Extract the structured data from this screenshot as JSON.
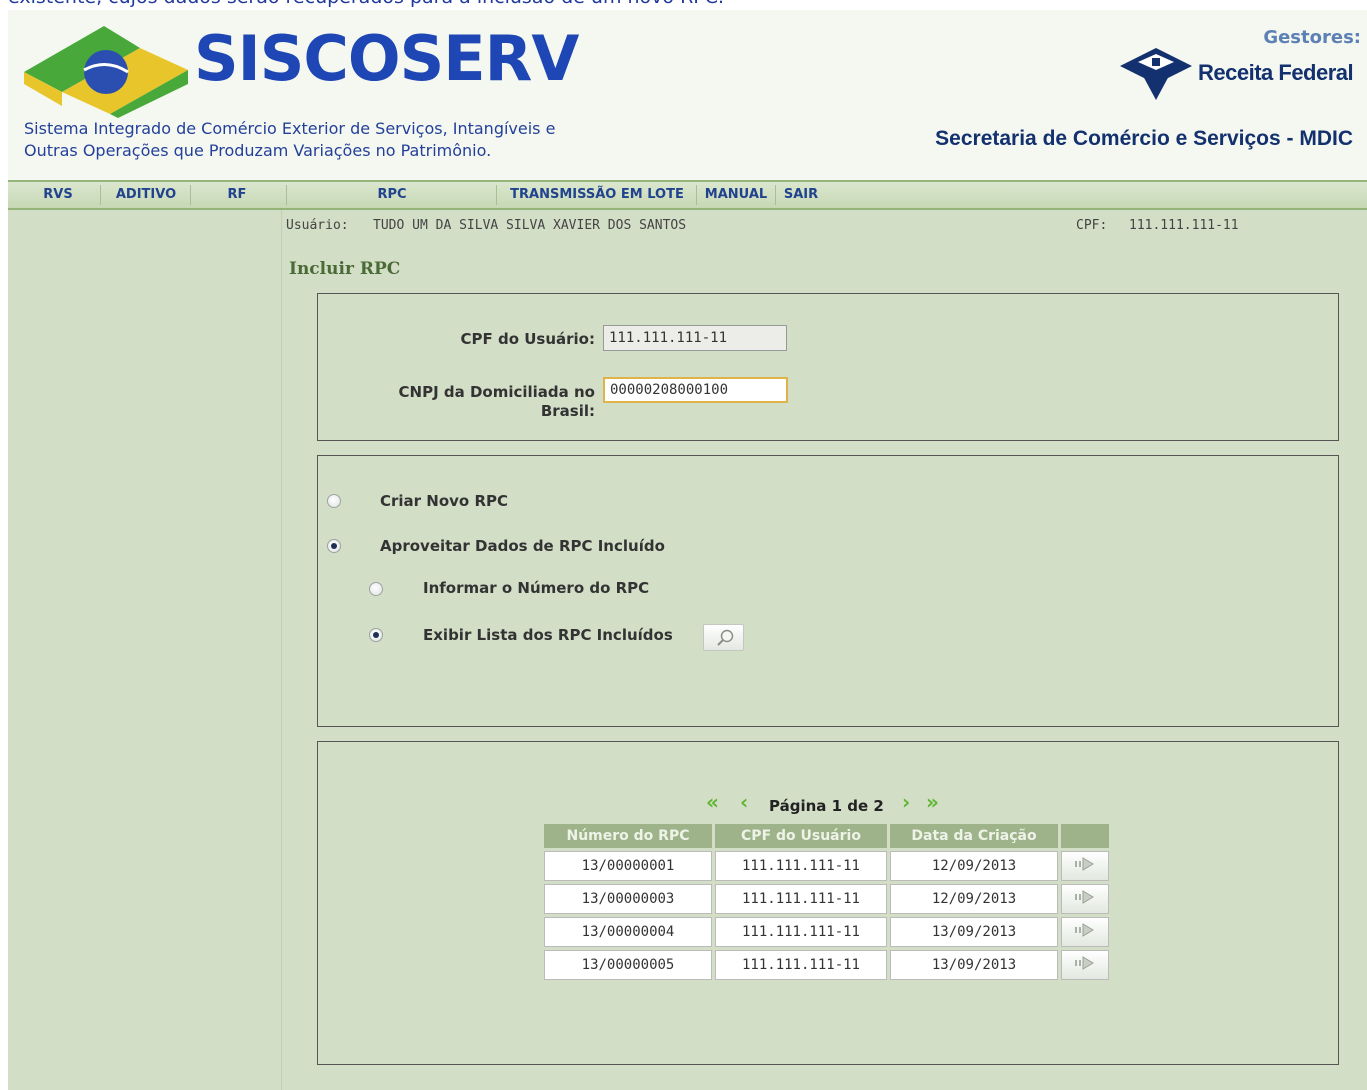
{
  "top_caption": "existente, cujos dados serão recuperados para a inclusão de um novo RPC.",
  "header": {
    "brand": "SISCOSERV",
    "subtitle_line1": "Sistema Integrado de Comércio Exterior de Serviços, Intangíveis e",
    "subtitle_line2": "Outras Operações que Produzam Variações no Patrimônio.",
    "gestores": "Gestores:",
    "rf_text": "Receita Federal",
    "secretaria": "Secretaria de Comércio e Serviços - MDIC"
  },
  "nav": {
    "items": [
      "RVS",
      "ADITIVO",
      "RF",
      "RPC",
      "TRANSMISSÃO EM LOTE",
      "MANUAL",
      "SAIR"
    ]
  },
  "user": {
    "label": "Usuário:",
    "name": "TUDO UM DA SILVA SILVA XAVIER DOS SANTOS",
    "cpf_label": "CPF:",
    "cpf": "111.111.111-11"
  },
  "page_title": "Incluir RPC",
  "form": {
    "cpf_label": "CPF do Usuário:",
    "cpf_value": "111.111.111-11",
    "cnpj_label_line1": "CNPJ da Domiciliada no",
    "cnpj_label_line2": "Brasil:",
    "cnpj_value": "00000208000100"
  },
  "options": {
    "criar_novo": "Criar Novo RPC",
    "aproveitar": "Aproveitar Dados de RPC Incluído",
    "informar_numero": "Informar o Número do RPC",
    "exibir_lista": "Exibir Lista dos RPC Incluídos",
    "selected_main": "aproveitar",
    "selected_sub": "exibir_lista"
  },
  "pager": {
    "text": "Página 1 de 2"
  },
  "table": {
    "headers": [
      "Número do RPC",
      "CPF do Usuário",
      "Data da Criação",
      ""
    ],
    "rows": [
      [
        "13/00000001",
        "111.111.111-11",
        "12/09/2013"
      ],
      [
        "13/00000003",
        "111.111.111-11",
        "12/09/2013"
      ],
      [
        "13/00000004",
        "111.111.111-11",
        "13/09/2013"
      ],
      [
        "13/00000005",
        "111.111.111-11",
        "13/09/2013"
      ]
    ]
  },
  "colors": {
    "content_bg": "#d3dec7",
    "brand_blue": "#1e46b4",
    "nav_text": "#21438e",
    "title_green": "#4a6a36",
    "pager_green": "#61b534",
    "table_header": "#9eb38a"
  }
}
